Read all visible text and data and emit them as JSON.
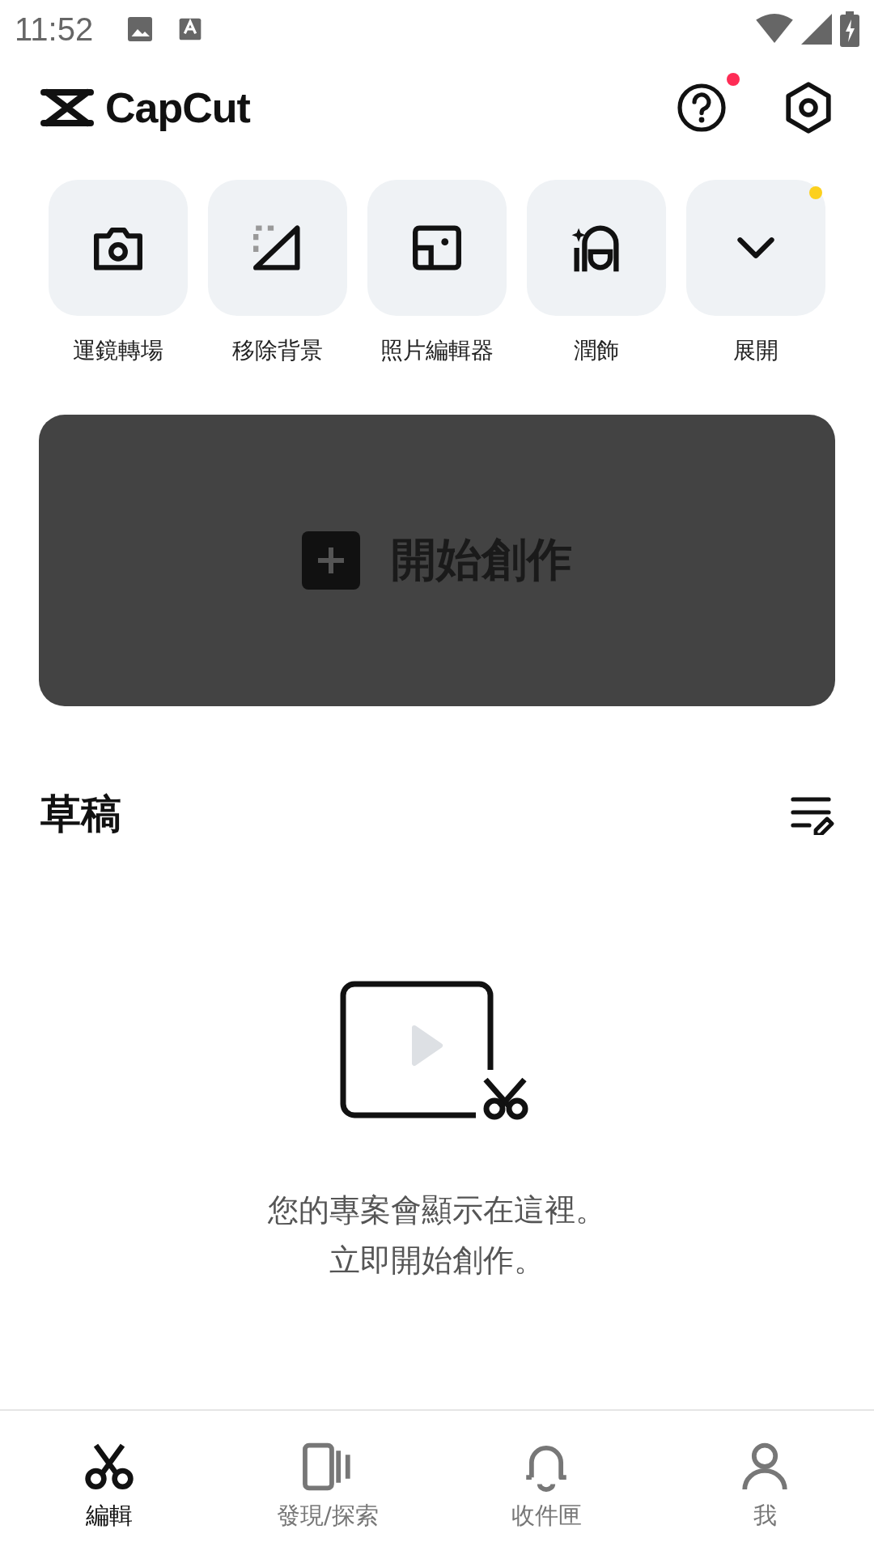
{
  "status_bar": {
    "time": "11:52"
  },
  "header": {
    "logo": "CapCut",
    "actions": [
      {
        "kind": "help",
        "badge": true
      },
      {
        "kind": "settings",
        "badge": false
      }
    ]
  },
  "tools": [
    {
      "kind": "camera",
      "label": "運鏡轉場",
      "badge": false
    },
    {
      "kind": "remove-bg",
      "label": "移除背景",
      "badge": false
    },
    {
      "kind": "photo",
      "label": "照片編輯器",
      "badge": false
    },
    {
      "kind": "retouch",
      "label": "潤飾",
      "badge": false
    },
    {
      "kind": "expand",
      "label": "展開",
      "badge": true
    }
  ],
  "create": {
    "label": "開始創作"
  },
  "drafts": {
    "title": "草稿",
    "empty_lines": [
      "您的專案會顯示在這裡。",
      "立即開始創作。"
    ]
  },
  "nav": [
    {
      "kind": "edit",
      "label": "編輯",
      "selected": true
    },
    {
      "kind": "explore",
      "label": "發現/探索",
      "selected": false
    },
    {
      "kind": "inbox",
      "label": "收件匣",
      "selected": false
    },
    {
      "kind": "me",
      "label": "我",
      "selected": false
    }
  ]
}
